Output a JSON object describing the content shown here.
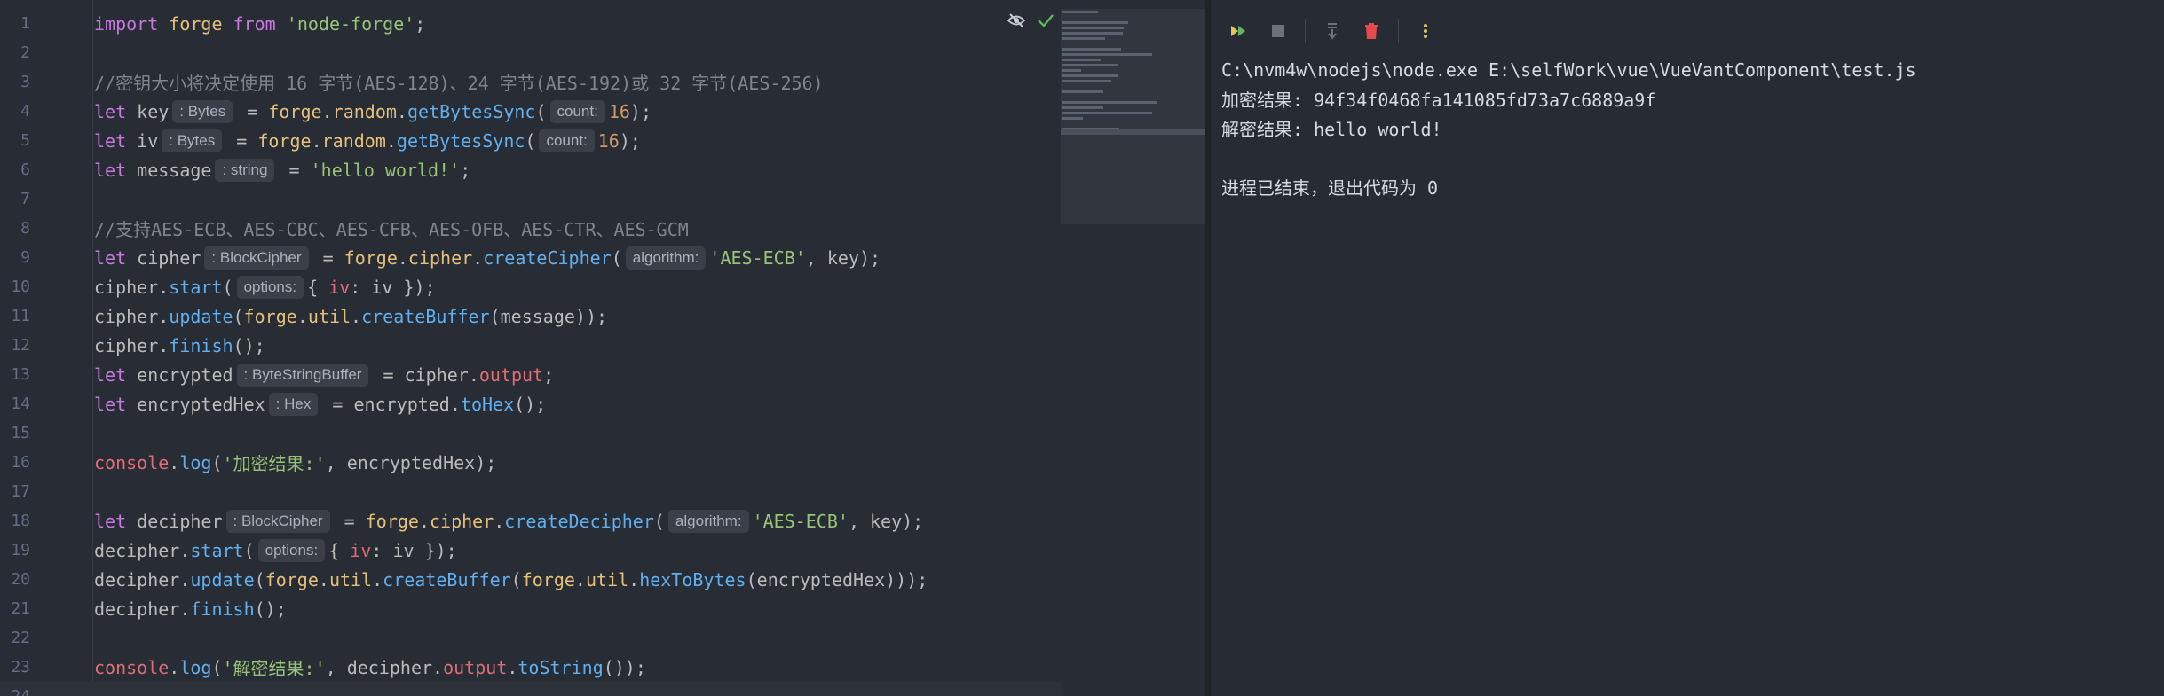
{
  "editor": {
    "lines": [
      {
        "n": "1",
        "tokens": [
          {
            "t": "import",
            "c": "kw"
          },
          {
            "t": " "
          },
          {
            "t": "forge",
            "c": "obj"
          },
          {
            "t": " "
          },
          {
            "t": "from",
            "c": "kw"
          },
          {
            "t": " "
          },
          {
            "t": "'node-forge'",
            "c": "str"
          },
          {
            "t": ";"
          }
        ]
      },
      {
        "n": "2",
        "tokens": []
      },
      {
        "n": "3",
        "tokens": [
          {
            "t": "//密钥大小将决定使用 16 字节(AES-128)、24 字节(AES-192)或 32 字节(AES-256)",
            "c": "cm"
          }
        ]
      },
      {
        "n": "4",
        "tokens": [
          {
            "t": "let",
            "c": "kw"
          },
          {
            "t": " key"
          },
          {
            "hint": ": Bytes"
          },
          {
            "t": " = "
          },
          {
            "t": "forge",
            "c": "obj"
          },
          {
            "t": "."
          },
          {
            "t": "random",
            "c": "obj"
          },
          {
            "t": "."
          },
          {
            "t": "getBytesSync",
            "c": "fn"
          },
          {
            "t": "("
          },
          {
            "hint": "count:"
          },
          {
            "t": "16",
            "c": "num"
          },
          {
            "t": ");"
          }
        ]
      },
      {
        "n": "5",
        "tokens": [
          {
            "t": "let",
            "c": "kw"
          },
          {
            "t": " iv"
          },
          {
            "hint": ": Bytes"
          },
          {
            "t": " = "
          },
          {
            "t": "forge",
            "c": "obj"
          },
          {
            "t": "."
          },
          {
            "t": "random",
            "c": "obj"
          },
          {
            "t": "."
          },
          {
            "t": "getBytesSync",
            "c": "fn"
          },
          {
            "t": "("
          },
          {
            "hint": "count:"
          },
          {
            "t": "16",
            "c": "num"
          },
          {
            "t": ");"
          }
        ]
      },
      {
        "n": "6",
        "tokens": [
          {
            "t": "let",
            "c": "kw"
          },
          {
            "t": " message"
          },
          {
            "hint": ": string"
          },
          {
            "t": " = "
          },
          {
            "t": "'hello world!'",
            "c": "str"
          },
          {
            "t": ";"
          }
        ]
      },
      {
        "n": "7",
        "tokens": []
      },
      {
        "n": "8",
        "tokens": [
          {
            "t": "//支持AES-ECB、AES-CBC、AES-CFB、AES-OFB、AES-CTR、AES-GCM",
            "c": "cm"
          }
        ]
      },
      {
        "n": "9",
        "tokens": [
          {
            "t": "let",
            "c": "kw"
          },
          {
            "t": " cipher"
          },
          {
            "hint": ": BlockCipher"
          },
          {
            "t": " = "
          },
          {
            "t": "forge",
            "c": "obj"
          },
          {
            "t": "."
          },
          {
            "t": "cipher",
            "c": "obj"
          },
          {
            "t": "."
          },
          {
            "t": "createCipher",
            "c": "fn"
          },
          {
            "t": "("
          },
          {
            "hint": "algorithm:"
          },
          {
            "t": "'AES-ECB'",
            "c": "str"
          },
          {
            "t": ", key);"
          }
        ]
      },
      {
        "n": "10",
        "tokens": [
          {
            "t": "cipher."
          },
          {
            "t": "start",
            "c": "fn"
          },
          {
            "t": "("
          },
          {
            "hint": "options:"
          },
          {
            "t": "{ "
          },
          {
            "t": "iv",
            "c": "prop"
          },
          {
            "t": ": iv });"
          }
        ]
      },
      {
        "n": "11",
        "tokens": [
          {
            "t": "cipher."
          },
          {
            "t": "update",
            "c": "fn"
          },
          {
            "t": "("
          },
          {
            "t": "forge",
            "c": "obj"
          },
          {
            "t": "."
          },
          {
            "t": "util",
            "c": "obj"
          },
          {
            "t": "."
          },
          {
            "t": "createBuffer",
            "c": "fn"
          },
          {
            "t": "(message));"
          }
        ]
      },
      {
        "n": "12",
        "tokens": [
          {
            "t": "cipher."
          },
          {
            "t": "finish",
            "c": "fn"
          },
          {
            "t": "();"
          }
        ]
      },
      {
        "n": "13",
        "tokens": [
          {
            "t": "let",
            "c": "kw"
          },
          {
            "t": " encrypted"
          },
          {
            "hint": ": ByteStringBuffer"
          },
          {
            "t": " = cipher."
          },
          {
            "t": "output",
            "c": "prop"
          },
          {
            "t": ";"
          }
        ]
      },
      {
        "n": "14",
        "tokens": [
          {
            "t": "let",
            "c": "kw"
          },
          {
            "t": " encryptedHex"
          },
          {
            "hint": ": Hex"
          },
          {
            "t": " = encrypted."
          },
          {
            "t": "toHex",
            "c": "fn"
          },
          {
            "t": "();"
          }
        ]
      },
      {
        "n": "15",
        "tokens": []
      },
      {
        "n": "16",
        "tokens": [
          {
            "t": "console",
            "c": "con"
          },
          {
            "t": "."
          },
          {
            "t": "log",
            "c": "fn"
          },
          {
            "t": "("
          },
          {
            "t": "'加密结果:'",
            "c": "str"
          },
          {
            "t": ", encryptedHex);"
          }
        ]
      },
      {
        "n": "17",
        "tokens": []
      },
      {
        "n": "18",
        "tokens": [
          {
            "t": "let",
            "c": "kw"
          },
          {
            "t": " decipher"
          },
          {
            "hint": ": BlockCipher"
          },
          {
            "t": " = "
          },
          {
            "t": "forge",
            "c": "obj"
          },
          {
            "t": "."
          },
          {
            "t": "cipher",
            "c": "obj"
          },
          {
            "t": "."
          },
          {
            "t": "createDecipher",
            "c": "fn"
          },
          {
            "t": "("
          },
          {
            "hint": "algorithm:"
          },
          {
            "t": "'AES-ECB'",
            "c": "str"
          },
          {
            "t": ", key);"
          }
        ]
      },
      {
        "n": "19",
        "tokens": [
          {
            "t": "decipher."
          },
          {
            "t": "start",
            "c": "fn"
          },
          {
            "t": "("
          },
          {
            "hint": "options:"
          },
          {
            "t": "{ "
          },
          {
            "t": "iv",
            "c": "prop"
          },
          {
            "t": ": iv });"
          }
        ]
      },
      {
        "n": "20",
        "tokens": [
          {
            "t": "decipher."
          },
          {
            "t": "update",
            "c": "fn"
          },
          {
            "t": "("
          },
          {
            "t": "forge",
            "c": "obj"
          },
          {
            "t": "."
          },
          {
            "t": "util",
            "c": "obj"
          },
          {
            "t": "."
          },
          {
            "t": "createBuffer",
            "c": "fn"
          },
          {
            "t": "("
          },
          {
            "t": "forge",
            "c": "obj"
          },
          {
            "t": "."
          },
          {
            "t": "util",
            "c": "obj"
          },
          {
            "t": "."
          },
          {
            "t": "hexToBytes",
            "c": "fn"
          },
          {
            "t": "(encryptedHex)));"
          }
        ]
      },
      {
        "n": "21",
        "tokens": [
          {
            "t": "decipher."
          },
          {
            "t": "finish",
            "c": "fn"
          },
          {
            "t": "();"
          }
        ]
      },
      {
        "n": "22",
        "tokens": []
      },
      {
        "n": "23",
        "tokens": [
          {
            "t": "console",
            "c": "con"
          },
          {
            "t": "."
          },
          {
            "t": "log",
            "c": "fn"
          },
          {
            "t": "("
          },
          {
            "t": "'解密结果:'",
            "c": "str"
          },
          {
            "t": ", decipher."
          },
          {
            "t": "output",
            "c": "prop"
          },
          {
            "t": "."
          },
          {
            "t": "toString",
            "c": "fn"
          },
          {
            "t": "());"
          }
        ]
      },
      {
        "n": "24",
        "tokens": []
      }
    ],
    "current_line": "24",
    "status_icons": [
      "eye-off-icon",
      "check-icon"
    ]
  },
  "console": {
    "toolbar": [
      {
        "name": "rerun-icon",
        "label": "Rerun"
      },
      {
        "name": "stop-icon",
        "label": "Stop"
      },
      {
        "name": "scroll-to-end-icon",
        "label": "Scroll to end"
      },
      {
        "name": "clear-icon",
        "label": "Clear"
      },
      {
        "name": "more-icon",
        "label": "More"
      }
    ],
    "lines": [
      "C:\\nvm4w\\nodejs\\node.exe E:\\selfWork\\vue\\VueVantComponent\\test.js",
      "加密结果: 94f34f0468fa141085fd73a7c6889a9f",
      "解密结果: hello world!",
      "",
      "进程已结束，退出代码为 0"
    ]
  },
  "colors": {
    "editor_bg": "#282c34",
    "console_bg": "#272b33",
    "keyword": "#c678dd",
    "string": "#98c379",
    "function": "#61afef",
    "object": "#e5c07b",
    "number": "#d19a66",
    "comment": "#7f848e",
    "property": "#e06c75"
  }
}
